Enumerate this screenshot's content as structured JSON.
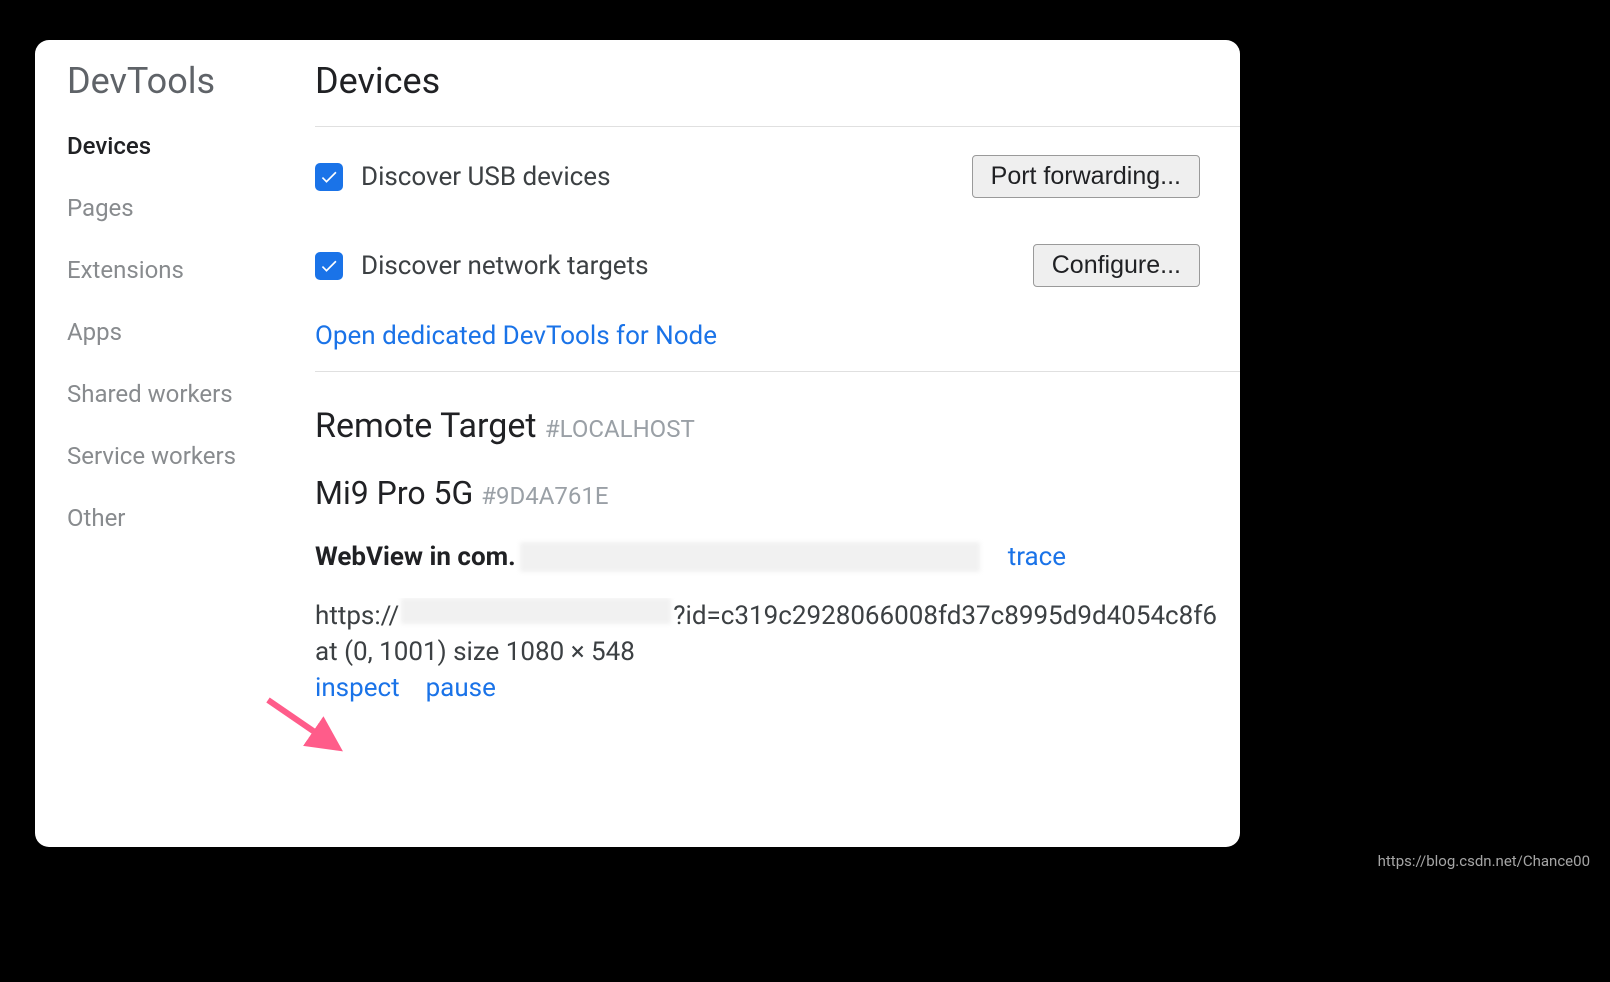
{
  "sidebar": {
    "title": "DevTools",
    "items": [
      {
        "label": "Devices",
        "active": true
      },
      {
        "label": "Pages",
        "active": false
      },
      {
        "label": "Extensions",
        "active": false
      },
      {
        "label": "Apps",
        "active": false
      },
      {
        "label": "Shared workers",
        "active": false
      },
      {
        "label": "Service workers",
        "active": false
      },
      {
        "label": "Other",
        "active": false
      }
    ]
  },
  "main": {
    "title": "Devices",
    "discover_usb": {
      "label": "Discover USB devices",
      "checked": true
    },
    "port_forwarding_btn": "Port forwarding...",
    "discover_network": {
      "label": "Discover network targets",
      "checked": true
    },
    "configure_btn": "Configure...",
    "node_link": "Open dedicated DevTools for Node",
    "remote_target": {
      "label": "Remote Target",
      "badge": "#LOCALHOST"
    },
    "device": {
      "name": "Mi9 Pro 5G",
      "badge": "#9D4A761E"
    },
    "webview": {
      "prefix": "WebView in com.",
      "trace": "trace"
    },
    "url": {
      "prefix": "https://",
      "mid": "?id=c319c2928066008fd37c8995d9d4054c8f6"
    },
    "position_size": "at (0, 1001)  size 1080 × 548",
    "actions": {
      "inspect": "inspect",
      "pause": "pause"
    }
  },
  "attribution": "https://blog.csdn.net/Chance00"
}
